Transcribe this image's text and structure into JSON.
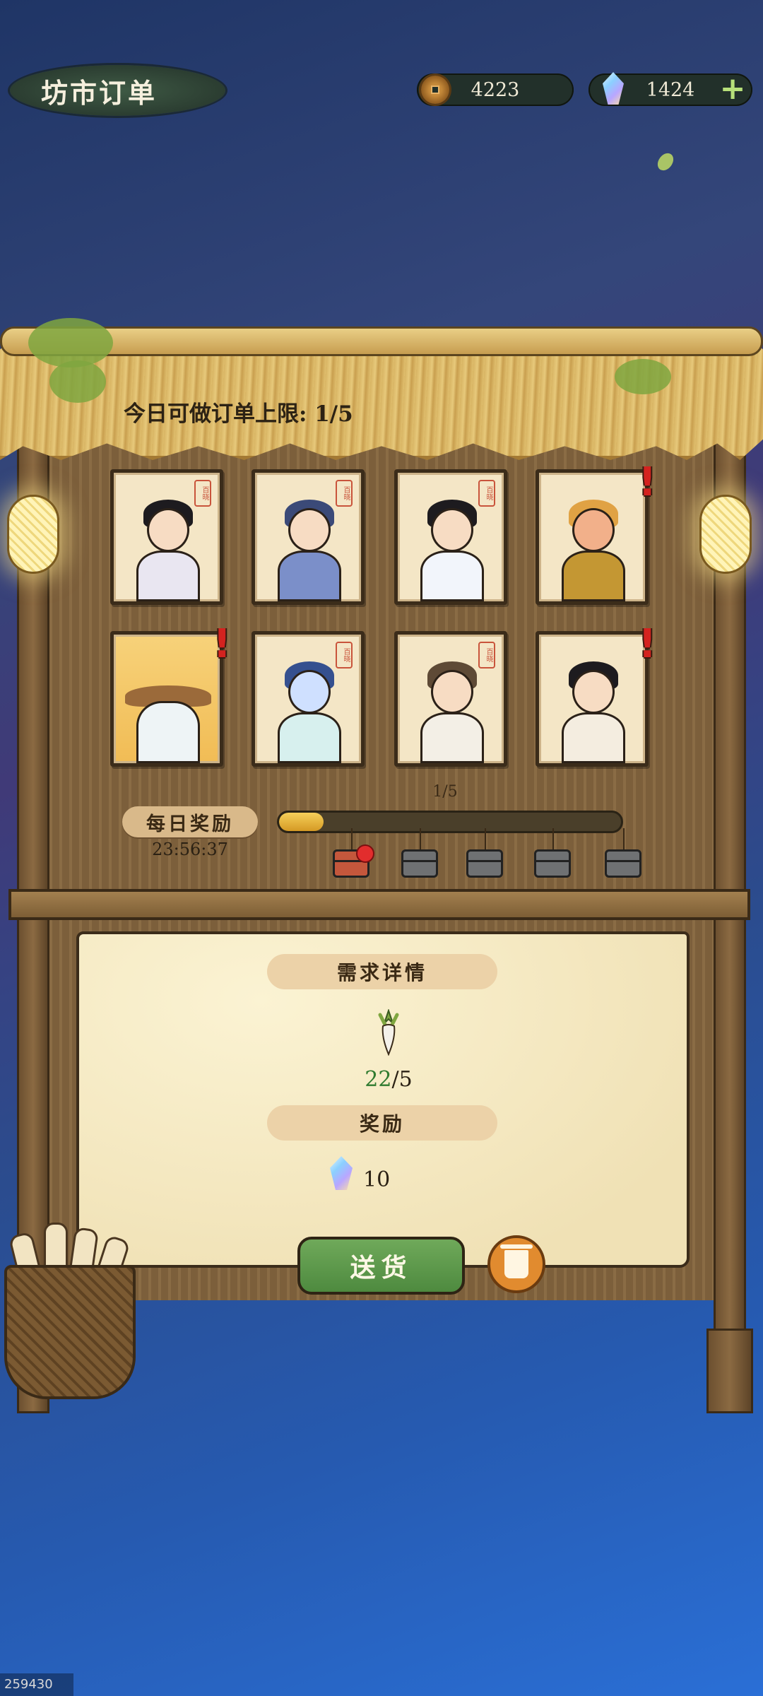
{
  "header": {
    "title": "坊市订单",
    "coins": "4223",
    "gems": "1424",
    "add_label": "+"
  },
  "board": {
    "order_limit_text": "今日可做订单上限: 1/5",
    "cards": [
      {
        "name": "young-swordsman",
        "alert": false
      },
      {
        "name": "dragon-horn-lady",
        "alert": false
      },
      {
        "name": "bun-hair-girl",
        "alert": false
      },
      {
        "name": "monkey-king",
        "alert": true
      },
      {
        "name": "masked-hat-figure",
        "alert": true
      },
      {
        "name": "blue-dragon",
        "alert": false
      },
      {
        "name": "old-farmer",
        "alert": false
      },
      {
        "name": "farm-boy",
        "alert": true
      }
    ],
    "seal_text": "百晓"
  },
  "daily_reward": {
    "label": "每日奖励",
    "timer": "23:56:37",
    "progress_text": "1/5",
    "progress_value": 0.13,
    "chests": [
      "open",
      "locked",
      "locked",
      "locked",
      "locked"
    ]
  },
  "details": {
    "need_title": "需求详情",
    "item_icon": "radish-icon",
    "have": "22",
    "need": "/5",
    "reward_title": "奖励",
    "reward_icon": "gem-icon",
    "reward_amount": "10"
  },
  "actions": {
    "deliver_label": "送货",
    "discard_icon": "trash-icon"
  },
  "watermark": "259430"
}
